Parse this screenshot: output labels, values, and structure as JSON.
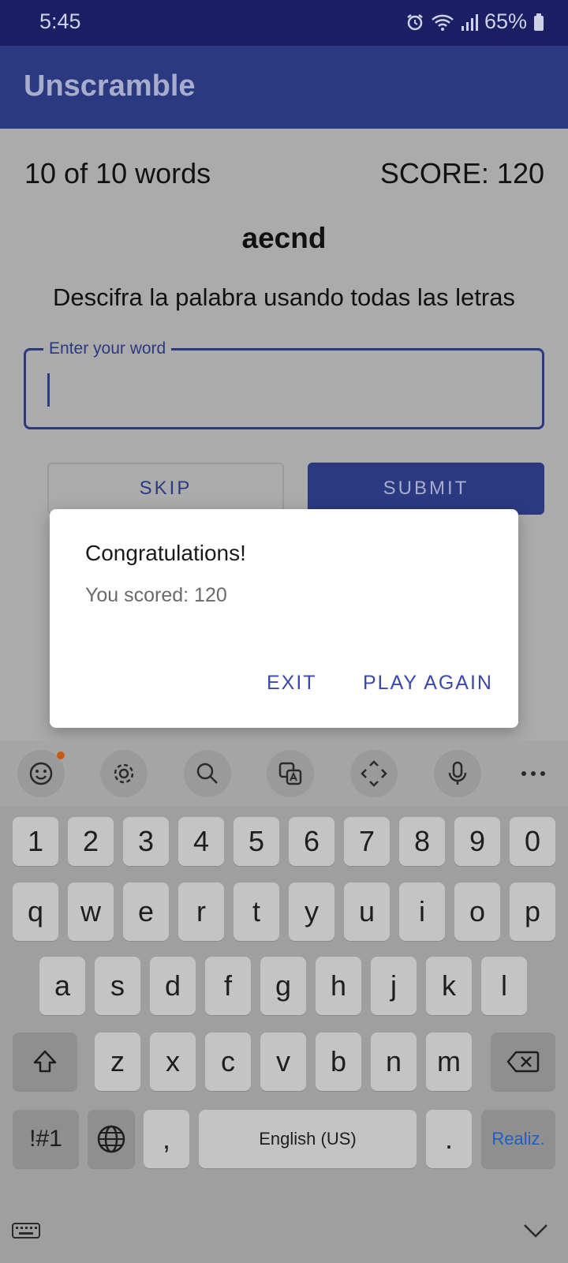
{
  "status_bar": {
    "time": "5:45",
    "battery": "65%"
  },
  "app_bar": {
    "title": "Unscramble"
  },
  "game": {
    "word_count": "10 of 10 words",
    "score": "SCORE: 120",
    "scrambled_word": "aecnd",
    "instructions": "Descifra la palabra usando todas las letras",
    "input_label": "Enter your word",
    "input_value": "",
    "skip_label": "SKIP",
    "submit_label": "SUBMIT"
  },
  "dialog": {
    "title": "Congratulations!",
    "message": "You scored: 120",
    "exit_label": "EXIT",
    "play_again_label": "PLAY AGAIN"
  },
  "keyboard": {
    "toolbar_icons": [
      "emoji-icon",
      "settings-icon",
      "search-icon",
      "translate-icon",
      "cursor-move-icon",
      "microphone-icon",
      "more-icon"
    ],
    "number_row": [
      "1",
      "2",
      "3",
      "4",
      "5",
      "6",
      "7",
      "8",
      "9",
      "0"
    ],
    "row1": [
      "q",
      "w",
      "e",
      "r",
      "t",
      "y",
      "u",
      "i",
      "o",
      "p"
    ],
    "row2": [
      "a",
      "s",
      "d",
      "f",
      "g",
      "h",
      "j",
      "k",
      "l"
    ],
    "row3": [
      "z",
      "x",
      "c",
      "v",
      "b",
      "n",
      "m"
    ],
    "symbols_label": "!#1",
    "comma_label": ",",
    "space_label": "English (US)",
    "period_label": ".",
    "done_label": "Realiz."
  },
  "colors": {
    "primary": "#2b3a80",
    "status_bar": "#1a2063",
    "dialog_button": "#3949ab",
    "done_key": "#1e5fc0"
  }
}
